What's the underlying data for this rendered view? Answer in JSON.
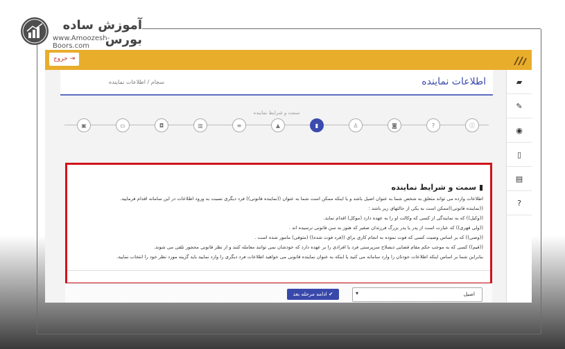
{
  "logo": {
    "title": "آموزش ساده بورس",
    "url": "www.Amoozesh-Boors.com"
  },
  "topbar": {
    "exit_label": "خروج"
  },
  "page": {
    "title": "اطلاعات نماینده",
    "breadcrumb": "سجام / اطلاعات نماینده"
  },
  "steps": {
    "current_label": "سمت و شرایط نماینده"
  },
  "section": {
    "title": "سمت و شرایط نماینده",
    "lines": [
      "اطلاعات وارده می تواند متعلق به شخص شما به عنوان اصیل باشد و یا اینکه ممکن است شما به عنوان ((نماینده قانونی)) فرد دیگری نسبت به ورود اطلاعات در این سامانه اقدام فرمایید.",
      "((نماینده قانونی))ممکن است به یکی از حالتهای زیر باشد :",
      "((وکیل)) که به نمایندگی از کسی که وکالت او را به عهده دارد (موکل) اقدام نماید.",
      "((ولی قهری)) که عبارت است از پدر یا پدر بزرگ فرزندان صغیر که هنوز به سن قانونی نرسیده اند .",
      "((وصی)) که بر اساس وصیت کسی که فوت نموده به انجام کاری برای ((فرد فوت شده)) (متوفی) مامور شده است .",
      "((قیم)) کسی که به موجب حکم مقام قضایی ذیصلاح سرپرستی فرد یا افرادی را بر عهده دارد که خودشان نمی توانند معامله کنند و از نظر قانونی محجور تلقی می شوند.",
      "بنابراین شما بر اساس اینکه اطلاعات خودتان را وارد سامانه می کنید یا اینکه به عنوان نماینده قانونی می خواهید اطلاعات فرد دیگری را وارد نمایید باید گزینه مورد نظر خود را انتخاب نمایید."
    ]
  },
  "actions": {
    "continue_label": "ادامه مرحله بعد",
    "select_value": "اصیل"
  },
  "colors": {
    "accent": "#3949ab",
    "topbar": "#e9ad2c",
    "highlight": "#d1121b"
  }
}
